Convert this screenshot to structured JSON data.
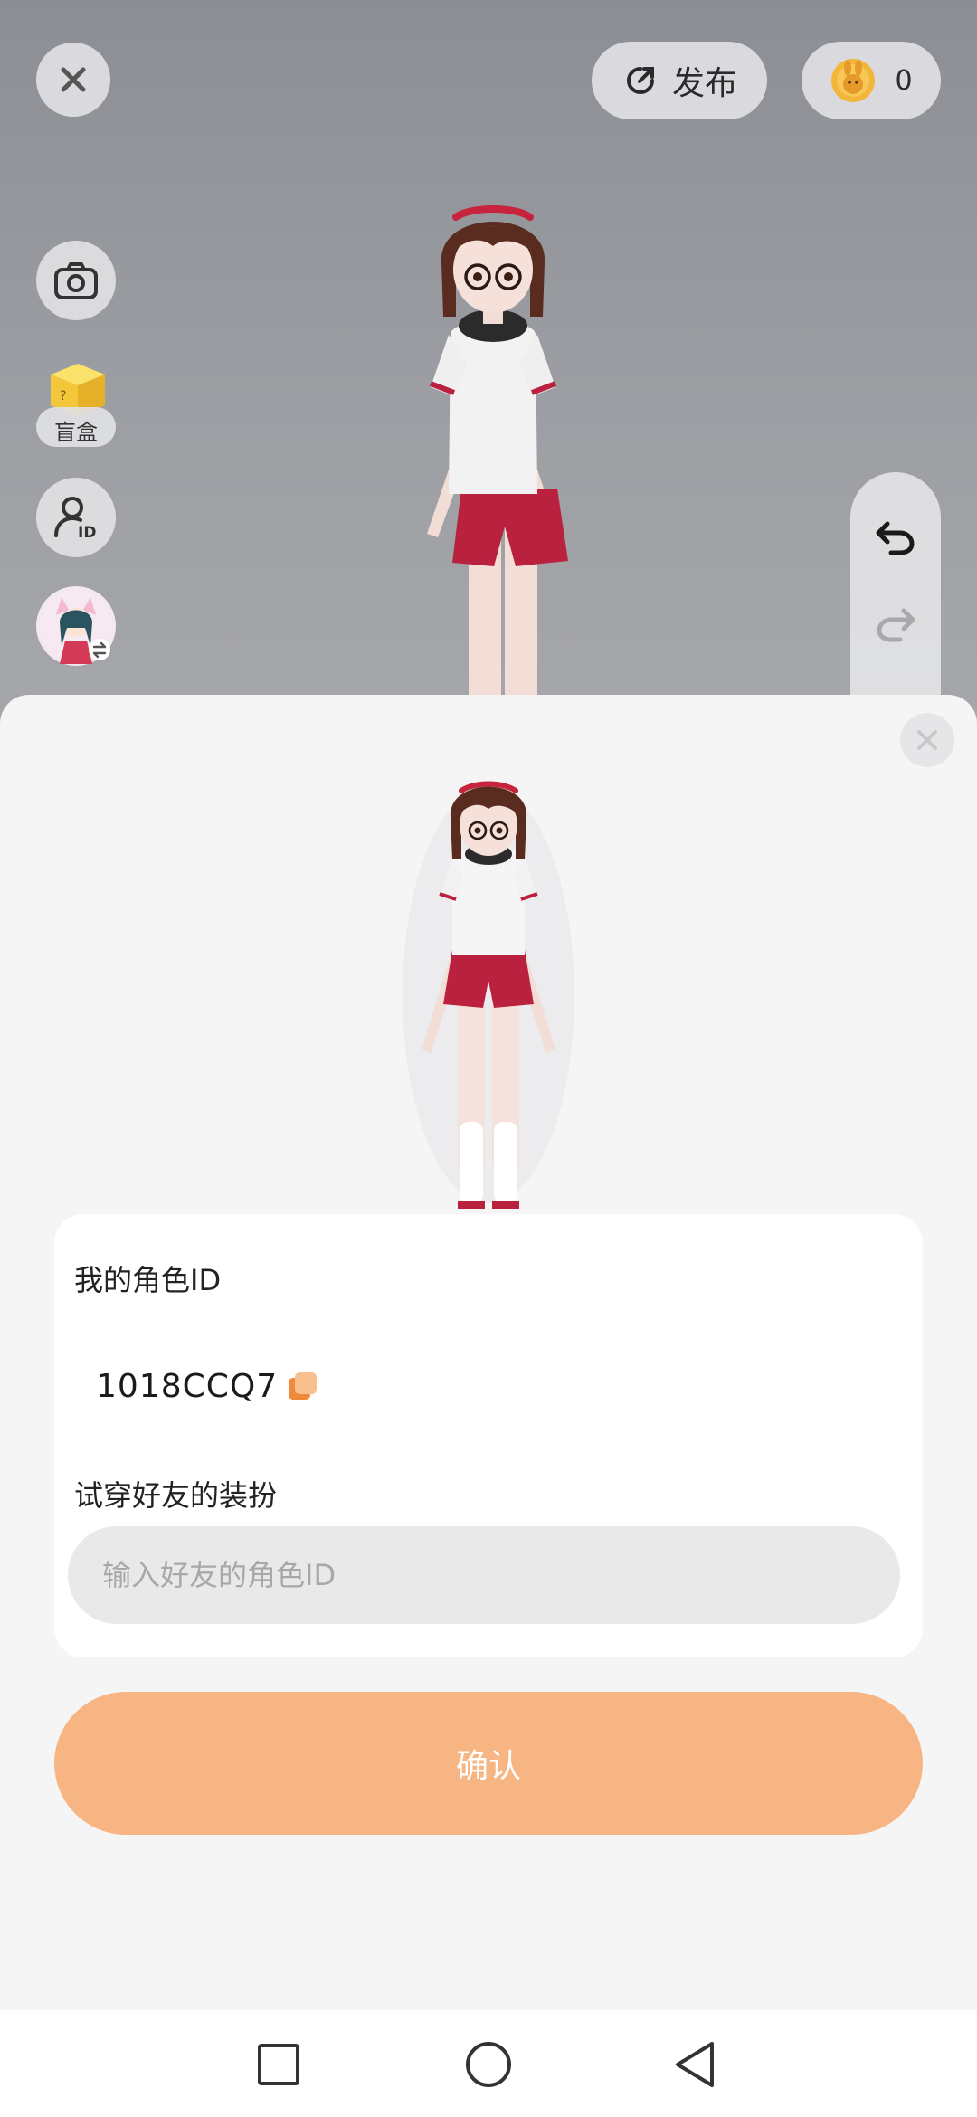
{
  "toolbar": {
    "publish_label": "发布",
    "coin_count": "0"
  },
  "side_menu": {
    "blind_box_label": "盲盒"
  },
  "sheet": {
    "my_id_label": "我的角色ID",
    "my_id_value": "1018CCQ7",
    "try_on_label": "试穿好友的装扮",
    "friend_id_placeholder": "输入好友的角色ID",
    "confirm_label": "确认"
  },
  "colors": {
    "accent": "#f8b584",
    "stage_bg": "#9c9ea3"
  },
  "icons": [
    "close-icon",
    "publish-icon",
    "coin-icon",
    "camera-icon",
    "blind-box-icon",
    "character-id-icon",
    "avatar-switch-icon",
    "undo-icon",
    "redo-icon",
    "copy-icon",
    "square-nav-icon",
    "circle-nav-icon",
    "back-triangle-icon"
  ]
}
